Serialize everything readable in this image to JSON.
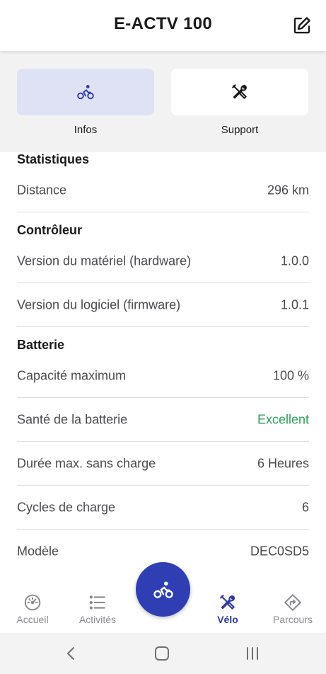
{
  "header": {
    "title": "E-ACTV 100",
    "edit_icon": "edit-icon"
  },
  "tabs": [
    {
      "label": "Infos",
      "icon": "bicycle-icon",
      "active": true
    },
    {
      "label": "Support",
      "icon": "tools-icon",
      "active": false
    }
  ],
  "sections": {
    "stats": {
      "title": "Statistiques",
      "rows": [
        {
          "label": "Distance",
          "value": "296 km"
        }
      ]
    },
    "controller": {
      "title": "Contrôleur",
      "rows": [
        {
          "label": "Version du matériel (hardware)",
          "value": "1.0.0"
        },
        {
          "label": "Version du logiciel (firmware)",
          "value": "1.0.1"
        }
      ]
    },
    "battery": {
      "title": "Batterie",
      "rows": [
        {
          "label": "Capacité maximum",
          "value": "100 %"
        },
        {
          "label": "Santé de la batterie",
          "value": "Excellent"
        },
        {
          "label": "Durée max. sans charge",
          "value": "6 Heures"
        },
        {
          "label": "Cycles de charge",
          "value": "6"
        },
        {
          "label": "Modèle",
          "value": "DEC0SD5"
        }
      ]
    }
  },
  "bottom_nav": [
    {
      "label": "Accueil",
      "icon": "speedometer-icon"
    },
    {
      "label": "Activités",
      "icon": "list-icon"
    },
    {
      "label": "Vélo",
      "icon": "tools-icon",
      "active": true
    },
    {
      "label": "Parcours",
      "icon": "route-icon"
    }
  ],
  "fab_icon": "bicycle-icon",
  "colors": {
    "primary": "#2f3fb3",
    "active_tab_bg": "#dfe1f5",
    "good_status": "#2e9e5b",
    "nav_active": "#2e3a9e",
    "nav_inactive": "#8a8a8e"
  }
}
